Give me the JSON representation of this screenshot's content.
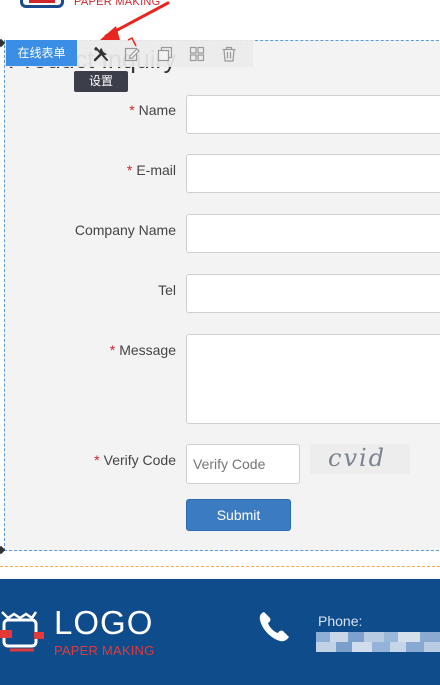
{
  "header": {
    "brand_tagline": "PAPER MAKING"
  },
  "toolbar": {
    "tag_label": "在线表单",
    "settings_tooltip": "设置",
    "icons": [
      "settings-icon",
      "edit-icon",
      "copy-icon",
      "grid-icon",
      "delete-icon"
    ]
  },
  "page": {
    "title": "Product Inquiry"
  },
  "form": {
    "fields": [
      {
        "label": "Name",
        "required": true,
        "value": "",
        "placeholder": ""
      },
      {
        "label": "E-mail",
        "required": true,
        "value": "",
        "placeholder": ""
      },
      {
        "label": "Company Name",
        "required": false,
        "value": "",
        "placeholder": ""
      },
      {
        "label": "Tel",
        "required": false,
        "value": "",
        "placeholder": ""
      },
      {
        "label": "Message",
        "required": true,
        "value": "",
        "placeholder": ""
      }
    ],
    "required_mark": "*",
    "verify_label": "Verify Code",
    "verify_placeholder": "Verify Code",
    "captcha_text": "cvid",
    "submit_label": "Submit"
  },
  "footer": {
    "logo_text": "LOGO",
    "logo_subtitle": "PAPER MAKING",
    "phone_label": "Phone:"
  },
  "colors": {
    "accent_blue": "#3a8ee6",
    "button_blue": "#3b7bc1",
    "footer_blue": "#0f4c8c",
    "required_red": "#d0252c"
  }
}
